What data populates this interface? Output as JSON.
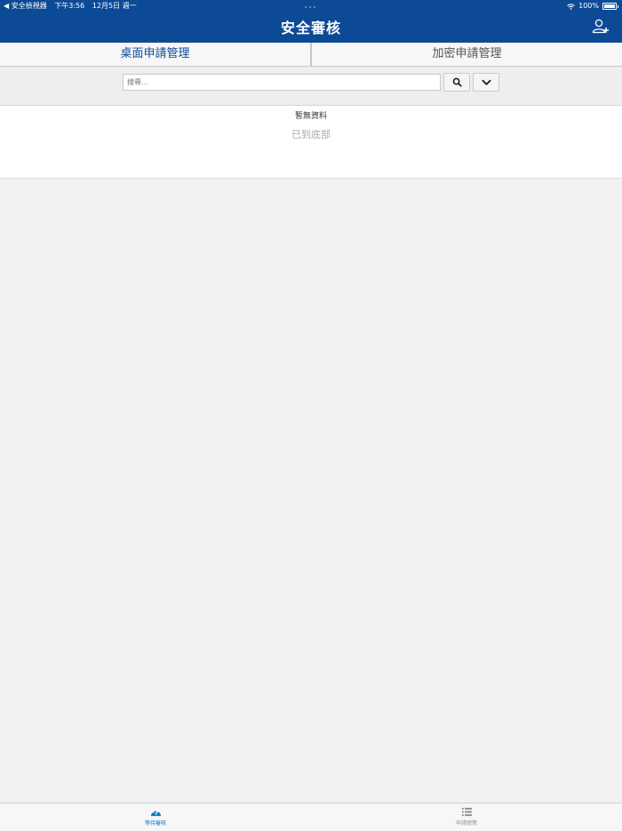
{
  "status_bar": {
    "back_app": "◀ 安全檢視器",
    "time": "下午3:56",
    "date": "12月5日 週一",
    "battery": "100%"
  },
  "header": {
    "title": "安全審核"
  },
  "segments": [
    {
      "label": "桌面申請管理",
      "active": true
    },
    {
      "label": "加密申請管理",
      "active": false
    }
  ],
  "search": {
    "placeholder": "搜尋...",
    "value": ""
  },
  "results": {
    "empty_message": "暫無資料",
    "end_message": "已到底部"
  },
  "tabbar": {
    "items": [
      {
        "label": "等待審核",
        "icon": "dashboard-icon",
        "active": true
      },
      {
        "label": "申請總覽",
        "icon": "list-icon",
        "active": false
      }
    ]
  },
  "colors": {
    "brand": "#0c4a96",
    "tab_active": "#0c79c2",
    "background": "#f2f2f4"
  }
}
